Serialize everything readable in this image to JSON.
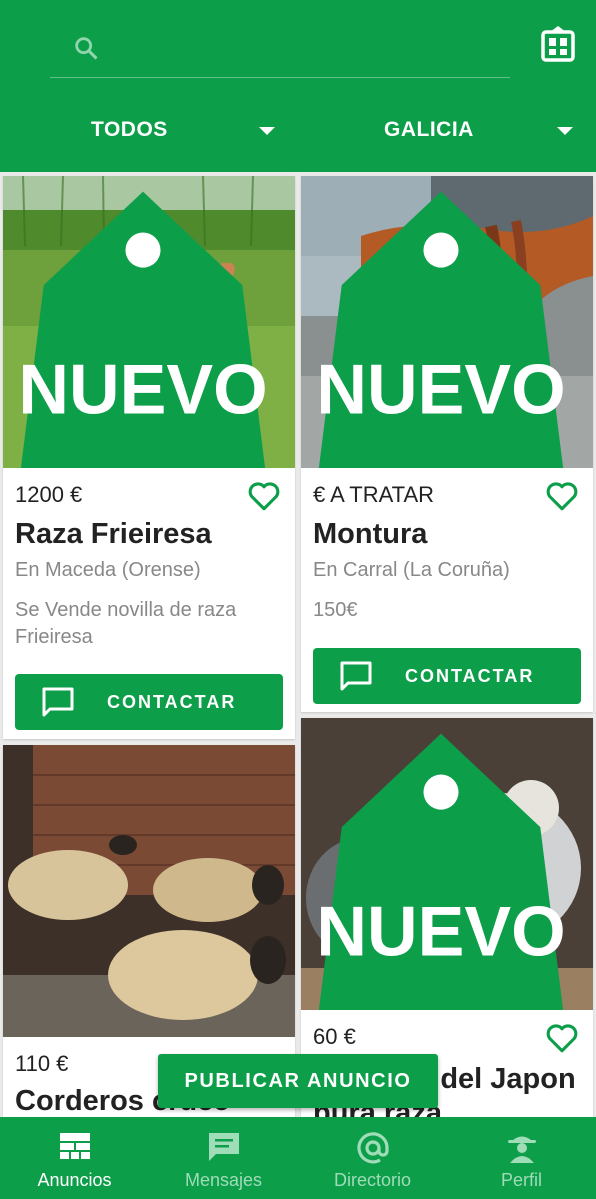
{
  "search": {
    "placeholder": ""
  },
  "filters": {
    "category": "TODOS",
    "region": "GALICIA"
  },
  "badge_label": "NUEVO",
  "listings": [
    {
      "price": "1200 €",
      "title": "Raza Frieiresa",
      "location": "En Maceda (Orense)",
      "description": "Se Vende novilla de raza Frieiresa",
      "contact_label": "CONTACTAR",
      "is_new": true
    },
    {
      "price": "€ A TRATAR",
      "title": "Montura",
      "location": "En Carral (La Coruña)",
      "description": "150€",
      "contact_label": "CONTACTAR",
      "is_new": true
    },
    {
      "price": "110 €",
      "title": "Corderos cruce",
      "is_new": false
    },
    {
      "price": "60 €",
      "title": "Sedosas del Japon pura raza",
      "is_new": true
    }
  ],
  "publish_label": "PUBLICAR ANUNCIO",
  "nav": [
    {
      "label": "Anuncios",
      "icon": "anuncios-icon",
      "active": true
    },
    {
      "label": "Mensajes",
      "icon": "chat-icon",
      "active": false
    },
    {
      "label": "Directorio",
      "icon": "at-icon",
      "active": false
    },
    {
      "label": "Perfil",
      "icon": "farmer-icon",
      "active": false
    }
  ],
  "colors": {
    "brand": "#0d9e4a",
    "inactive": "#9fdcb8"
  }
}
